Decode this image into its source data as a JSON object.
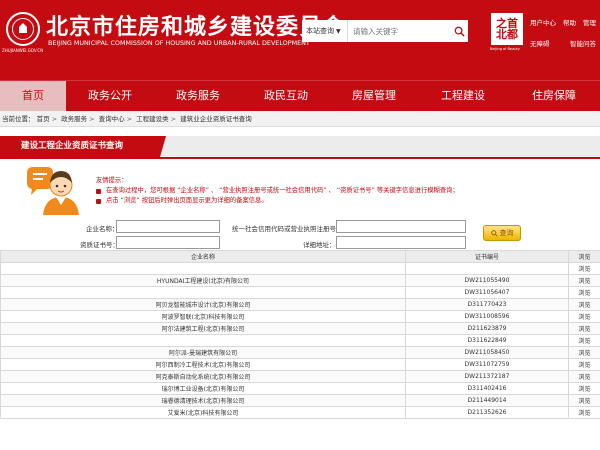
{
  "header": {
    "title": "北京市住房和城乡建设委员会",
    "subtitle": "BEIJING MUNICIPAL COMMISSION OF HOUSING AND URBAN-RURAL DEVELOPMENT",
    "logo_sub": "ZHUJIANWEI.GOV.CN",
    "search": {
      "scope": "本站查询",
      "placeholder": "请输入关键字"
    },
    "beijing_logo": {
      "text_top": "之首",
      "text_bottom": "北都",
      "sub": "Beijing of Beauty"
    },
    "toplinks": [
      "用户中心",
      "帮助",
      "管理",
      "无障碍",
      "智能问答"
    ]
  },
  "nav": {
    "items": [
      "首页",
      "政务公开",
      "政务服务",
      "政民互动",
      "房屋管理",
      "工程建设",
      "住房保障"
    ],
    "active_index": 0
  },
  "breadcrumb": {
    "prefix": "当前位置：",
    "items": [
      "首页",
      "政务服务",
      "查询中心",
      "工程建设类",
      "建筑业企业资质证书查询"
    ]
  },
  "section": {
    "title": "建设工程企业资质证书查询"
  },
  "hint": {
    "title": "友情提示：",
    "lines": [
      "在查询过程中，您可根据 “企业名称” 、 “营业执照注册号或统一社会信用代码” 、 “资质证书号” 等关键字信息进行模糊查询；",
      "点击 “浏览” 按钮后时弹出页面显示更为详细的备案信息。"
    ]
  },
  "form": {
    "company_label": "企业名称：",
    "license_label": "统一社会信用代码或营业执照注册号：",
    "cert_label": "资质证书号：",
    "address_label": "详细地址：",
    "query_button": "查询"
  },
  "table": {
    "headers": [
      "企业名称",
      "证书编号",
      "浏览"
    ],
    "rows": [
      {
        "name": "",
        "cert": "",
        "action": "浏览"
      },
      {
        "name": "HYUNDAI工程建设(北京)有限公司",
        "cert": "DW211055490",
        "action": "浏览"
      },
      {
        "name": "",
        "cert": "DW311056407",
        "action": "浏览"
      },
      {
        "name": "阿贝龙智能城市设计(北京)有限公司",
        "cert": "D311770423",
        "action": "浏览"
      },
      {
        "name": "阿波罗智联(北京)科技有限公司",
        "cert": "DW311008596",
        "action": "浏览"
      },
      {
        "name": "阿尔法建筑工程(北京)有限公司",
        "cert": "D211623879",
        "action": "浏览"
      },
      {
        "name": "",
        "cert": "D311622849",
        "action": "浏览"
      },
      {
        "name": "阿尔派-曼瑞建筑有限公司",
        "cert": "DW211058450",
        "action": "浏览"
      },
      {
        "name": "阿尔西制冷工程技术(北京)有限公司",
        "cert": "DW311072759",
        "action": "浏览"
      },
      {
        "name": "阿克泰斯自动化系统(北京)有限公司",
        "cert": "DW211372187",
        "action": "浏览"
      },
      {
        "name": "瑞尔博工业设备(北京)有限公司",
        "cert": "D311402416",
        "action": "浏览"
      },
      {
        "name": "瑞睿德清理技术(北京)有限公司",
        "cert": "D211449014",
        "action": "浏览"
      },
      {
        "name": "艾爱米(北京)科技有限公司",
        "cert": "D211352626",
        "action": "浏览"
      }
    ]
  },
  "colors": {
    "brand_red": "#c50b12",
    "nav_active_bg": "#e7bdbf",
    "query_button": "#f0b400"
  }
}
